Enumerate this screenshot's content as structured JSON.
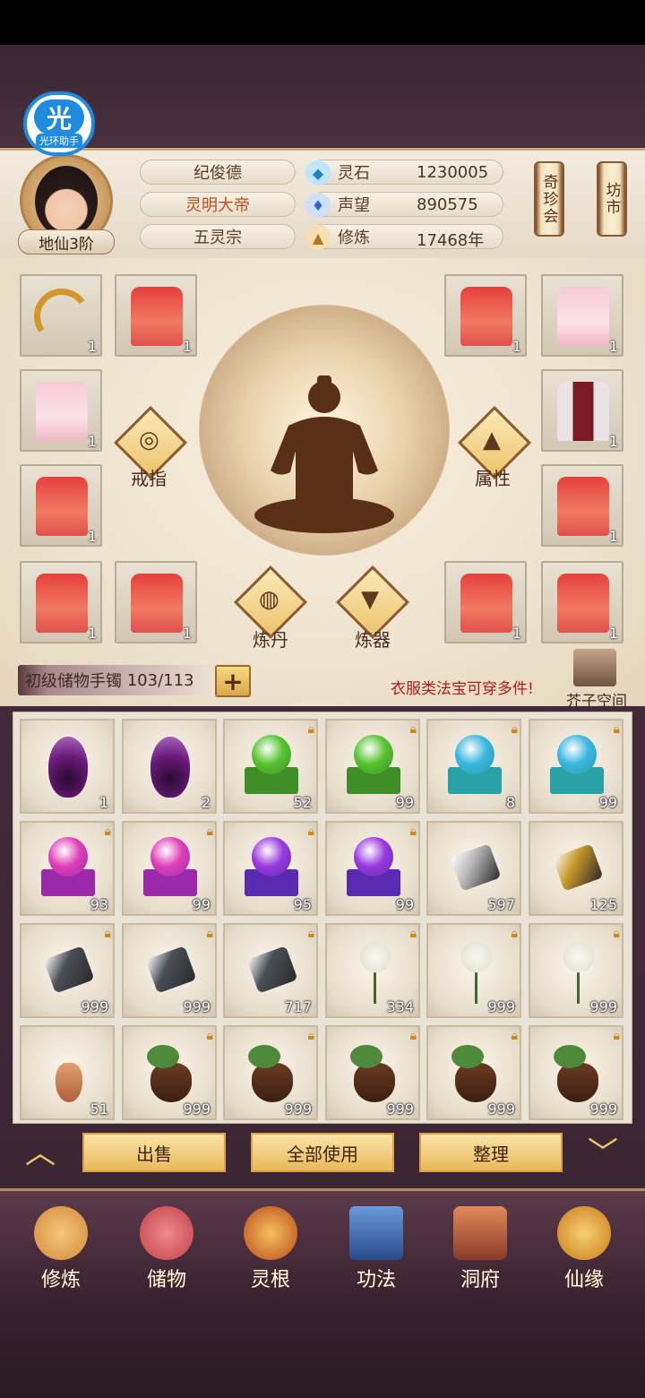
{
  "helper": {
    "glyph": "光",
    "label": "光环助手"
  },
  "player": {
    "name": "纪俊德",
    "title": "灵明大帝",
    "sect": "五灵宗",
    "realm": "地仙3阶"
  },
  "stats": [
    {
      "label": "灵石",
      "value": "1230005",
      "icon": "spirit-stone-icon",
      "color": "#3aa6e0"
    },
    {
      "label": "声望",
      "value": "890575",
      "icon": "reputation-icon",
      "color": "#3a7ee0"
    },
    {
      "label": "修炼",
      "value": "17468年",
      "icon": "cultivation-icon",
      "color": "#d08a30"
    }
  ],
  "side_buttons": [
    {
      "label": "奇珍会"
    },
    {
      "label": "坊市"
    }
  ],
  "equipment": {
    "slot_counts": [
      "1",
      "1",
      "1",
      "1",
      "1",
      "1",
      "1",
      "1",
      "1",
      "1",
      "1",
      "1"
    ],
    "ring_label": "戒指",
    "attr_label": "属性",
    "alchemy_label": "炼丹",
    "forge_label": "炼器"
  },
  "storage": {
    "name": "初级储物手镯",
    "capacity": "103/113",
    "add_label": "+",
    "hint": "衣服类法宝可穿多件!",
    "space_label": "芥子空间"
  },
  "items": [
    {
      "kind": "flame",
      "count": "1",
      "locked": false
    },
    {
      "kind": "flame",
      "count": "2",
      "locked": false
    },
    {
      "kind": "orb",
      "orb": "#57c430",
      "base": "#3f8f26",
      "count": "52",
      "locked": true
    },
    {
      "kind": "orb",
      "orb": "#57c430",
      "base": "#3f8f26",
      "count": "99",
      "locked": true
    },
    {
      "kind": "orb",
      "orb": "#3ab6e0",
      "base": "#2aa0a8",
      "count": "8",
      "locked": true
    },
    {
      "kind": "orb",
      "orb": "#3ab6e0",
      "base": "#2aa0a8",
      "count": "99",
      "locked": true
    },
    {
      "kind": "orb",
      "orb": "#e040b8",
      "base": "#9a2aaa",
      "count": "93",
      "locked": true
    },
    {
      "kind": "orb",
      "orb": "#e040b8",
      "base": "#9a2aaa",
      "count": "99",
      "locked": true
    },
    {
      "kind": "orb",
      "orb": "#9a3ae0",
      "base": "#5a2ab0",
      "count": "95",
      "locked": true
    },
    {
      "kind": "orb",
      "orb": "#9a3ae0",
      "base": "#5a2ab0",
      "count": "99",
      "locked": true
    },
    {
      "kind": "ore",
      "color": "#b8b8b8",
      "count": "597",
      "locked": false
    },
    {
      "kind": "ore",
      "color": "#c89a2a",
      "count": "125",
      "locked": false
    },
    {
      "kind": "ore",
      "color": "#4a4e56",
      "count": "999",
      "locked": true
    },
    {
      "kind": "ore",
      "color": "#4a4e56",
      "count": "999",
      "locked": true
    },
    {
      "kind": "ore",
      "color": "#4a4e56",
      "count": "717",
      "locked": true
    },
    {
      "kind": "flower",
      "count": "334",
      "locked": true
    },
    {
      "kind": "flower",
      "count": "999",
      "locked": true
    },
    {
      "kind": "flower",
      "count": "999",
      "locked": true
    },
    {
      "kind": "ginseng",
      "count": "51",
      "locked": false
    },
    {
      "kind": "root",
      "count": "999",
      "locked": true
    },
    {
      "kind": "root",
      "count": "999",
      "locked": true
    },
    {
      "kind": "root",
      "count": "999",
      "locked": true
    },
    {
      "kind": "root",
      "count": "999",
      "locked": true
    },
    {
      "kind": "root",
      "count": "999",
      "locked": true
    }
  ],
  "actions": [
    {
      "label": "出售"
    },
    {
      "label": "全部使用"
    },
    {
      "label": "整理"
    }
  ],
  "nav": [
    {
      "label": "修炼",
      "icon": "cultivate-icon",
      "color": "#d08a3a"
    },
    {
      "label": "储物",
      "icon": "bag-icon",
      "color": "#d0505a"
    },
    {
      "label": "灵根",
      "icon": "spirit-root-icon",
      "color": "#e07a2a"
    },
    {
      "label": "功法",
      "icon": "book-icon",
      "color": "#3a6ab0"
    },
    {
      "label": "洞府",
      "icon": "cave-dwelling-icon",
      "color": "#c05a3a"
    },
    {
      "label": "仙缘",
      "icon": "gourd-icon",
      "color": "#e0a030"
    }
  ]
}
